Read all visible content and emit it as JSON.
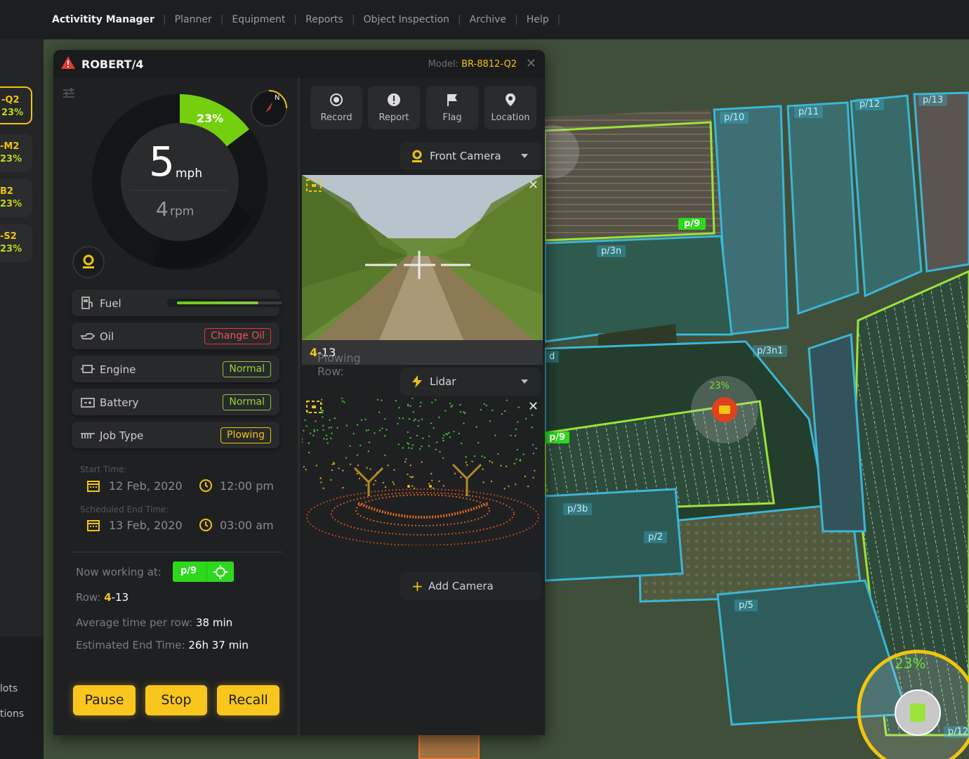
{
  "nav": {
    "items": [
      "Activitity Manager",
      "Planner",
      "Equipment",
      "Reports",
      "Object Inspection",
      "Archive",
      "Help"
    ],
    "active": "Activitity Manager"
  },
  "left_list": [
    {
      "code": "-Q2",
      "pct": "23%",
      "active": true
    },
    {
      "code": "-M2",
      "pct": "23%"
    },
    {
      "code": "B2",
      "pct": "23%"
    },
    {
      "code": "-S2",
      "pct": "23%"
    }
  ],
  "left_bottom": [
    "lots",
    "tions"
  ],
  "panel": {
    "title": "ROBERT/4",
    "model_label": "Model:",
    "model_value": "BR-8812-Q2",
    "gauge": {
      "speed": "5",
      "speed_unit": "mph",
      "rpm": "4",
      "rpm_unit": "rpm",
      "progress": "23%",
      "progress_value": 0.23
    },
    "status": {
      "fuel_label": "Fuel",
      "fuel_level": 0.77,
      "oil_label": "Oil",
      "oil_value": "Change Oil",
      "engine_label": "Engine",
      "engine_value": "Normal",
      "battery_label": "Battery",
      "battery_value": "Normal",
      "jobtype_label": "Job Type",
      "jobtype_value": "Plowing"
    },
    "schedule": {
      "start_label": "Start Time:",
      "start_date": "12 Feb, 2020",
      "start_time": "12:00 pm",
      "end_label": "Scheduled End Time:",
      "end_date": "13 Feb, 2020",
      "end_time": "03:00 am"
    },
    "working": {
      "now_label": "Now working at:",
      "plot": "p/9",
      "row_label": "Row:",
      "row_a": "4",
      "row_b": "-13",
      "avg_label": "Average time per row:",
      "avg_value": "38 min",
      "eta_label": "Estimated End Time:",
      "eta_value": "26h 37 min"
    },
    "buttons": {
      "pause": "Pause",
      "stop": "Stop",
      "recall": "Recall"
    },
    "tools": [
      "Record",
      "Report",
      "Flag",
      "Location"
    ],
    "front_camera": "Front Camera",
    "caption_label": "Plowing Row:",
    "caption_a": "4",
    "caption_b": "-13",
    "lidar": "Lidar",
    "add_camera": "Add Camera"
  },
  "map": {
    "plots": [
      "p/10",
      "p/11",
      "p/12",
      "p/13",
      "p/9",
      "p/3n",
      "p/3n1",
      "p/9",
      "p/3b",
      "p/2",
      "p/5",
      "p/12",
      "d"
    ],
    "robot_pct": "23%",
    "corner_pct": "23%",
    "colors": {
      "accent": "#f1c40f",
      "green": "#2dd81d",
      "cyan": "#3ab6d6"
    }
  }
}
